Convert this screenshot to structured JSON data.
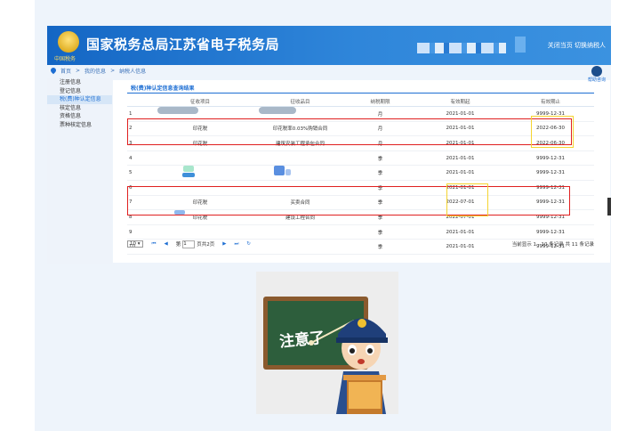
{
  "header": {
    "title": "国家税务总局江苏省电子税务局",
    "emblem_text": "中国税务",
    "links": "关闭当页  切换纳税人"
  },
  "breadcrumb": [
    "首页",
    ">",
    "我的信息",
    ">",
    "纳税人信息"
  ],
  "sidebar": {
    "items": [
      "注册信息",
      "登记信息",
      "税(费)种认定信息",
      "核定信息",
      "资格信息",
      "票种核定信息"
    ],
    "active_index": 2
  },
  "section_title": "税(费)种认定信息查询结果",
  "table": {
    "headers": [
      "",
      "征收项目",
      "征收品目",
      "纳税期限",
      "有效期起",
      "有效期止"
    ],
    "rows": [
      [
        "1",
        "",
        "",
        "月",
        "2021-01-01",
        "9999-12-31"
      ],
      [
        "2",
        "印花税",
        "印花税率0.03%购销合同",
        "月",
        "2021-01-01",
        "2022-06-30"
      ],
      [
        "3",
        "印花税",
        "建筑安装工程承包合同",
        "月",
        "2021-01-01",
        "2022-06-30"
      ],
      [
        "4",
        "",
        "",
        "季",
        "2021-01-01",
        "9999-12-31"
      ],
      [
        "5",
        "",
        "",
        "季",
        "2021-01-01",
        "9999-12-31"
      ],
      [
        "6",
        "",
        "",
        "季",
        "2021-01-01",
        "9999-12-31"
      ],
      [
        "7",
        "印花税",
        "买卖合同",
        "季",
        "2022-07-01",
        "9999-12-31"
      ],
      [
        "8",
        "印花税",
        "建设工程合同",
        "季",
        "2022-07-01",
        "9999-12-31"
      ],
      [
        "9",
        "",
        "",
        "季",
        "2021-01-01",
        "9999-12-31"
      ],
      [
        "10",
        "",
        "",
        "季",
        "2021-01-01",
        "9999-12-31"
      ]
    ]
  },
  "pager": {
    "page_size": "10 ▾",
    "page_label": "第",
    "page_value": "1",
    "page_total": "页共2页",
    "summary": "当前显示 1 - 10 条记录 共 11 条记录"
  },
  "help": {
    "label": "帮助咨询"
  },
  "notice": {
    "text": "注意了"
  },
  "colors": {
    "header_blue": "#1466c4",
    "highlight_red": "#e02020",
    "highlight_yellow": "#f5d430"
  }
}
